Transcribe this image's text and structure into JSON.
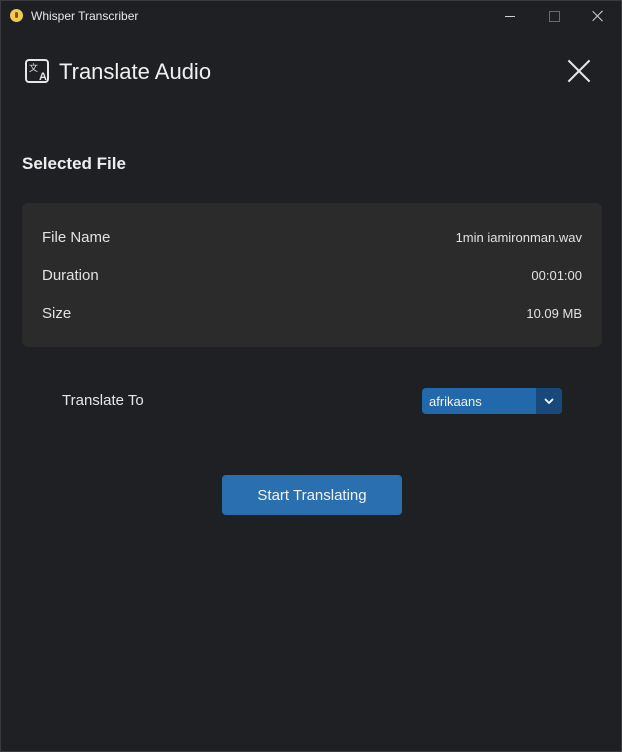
{
  "window": {
    "title": "Whisper Transcriber"
  },
  "header": {
    "title": "Translate Audio"
  },
  "selected_file": {
    "section_title": "Selected File",
    "rows": [
      {
        "label": "File Name",
        "value": "1min iamironman.wav"
      },
      {
        "label": "Duration",
        "value": "00:01:00"
      },
      {
        "label": "Size",
        "value": "10.09 MB"
      }
    ]
  },
  "translate": {
    "label": "Translate To",
    "selected_language": "afrikaans"
  },
  "actions": {
    "start_label": "Start Translating"
  },
  "icons": {
    "app": "lightbulb-icon",
    "header": "translate-icon",
    "close": "close-icon",
    "dropdown": "chevron-down-icon"
  },
  "colors": {
    "background": "#1f2024",
    "card": "#2b2b2b",
    "accent": "#2a6fb0",
    "accent_dark": "#19497a"
  }
}
